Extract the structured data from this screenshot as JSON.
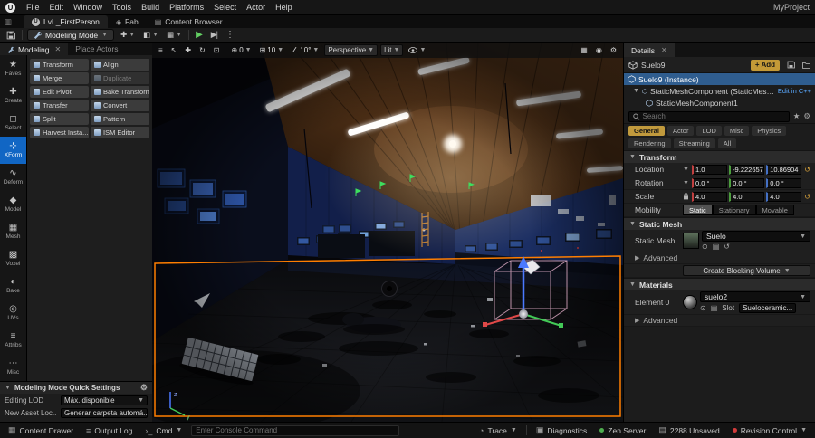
{
  "menubar": {
    "items": [
      "File",
      "Edit",
      "Window",
      "Tools",
      "Build",
      "Platforms",
      "Select",
      "Actor",
      "Help"
    ],
    "project": "MyProject"
  },
  "tabbar": {
    "level_tab": "LvL_FirstPerson",
    "fab": "Fab",
    "content_browser": "Content Browser"
  },
  "toolbar": {
    "mode_label": "Modeling Mode"
  },
  "left_tabs": {
    "modeling": "Modeling",
    "place_actors": "Place Actors"
  },
  "categories": [
    {
      "label": "Faves",
      "glyph": "★"
    },
    {
      "label": "Create",
      "glyph": "✚"
    },
    {
      "label": "Select",
      "glyph": "◻"
    },
    {
      "label": "XForm",
      "glyph": "⊹"
    },
    {
      "label": "Deform",
      "glyph": "∿"
    },
    {
      "label": "Model",
      "glyph": "◆"
    },
    {
      "label": "Mesh",
      "glyph": "▦"
    },
    {
      "label": "Voxel",
      "glyph": "▩"
    },
    {
      "label": "Bake",
      "glyph": "◐"
    },
    {
      "label": "UVs",
      "glyph": "◎"
    },
    {
      "label": "Attribs",
      "glyph": "≡"
    },
    {
      "label": "Misc",
      "glyph": "⋯"
    }
  ],
  "tools": {
    "col1": [
      "Transform",
      "Merge",
      "Edit Pivot",
      "Transfer",
      "Split",
      "Harvest Insta..."
    ],
    "col2": [
      "Align",
      "Duplicate",
      "Bake Transform",
      "Convert",
      "Pattern",
      "ISM Editor"
    ]
  },
  "quick_settings": {
    "title": "Modeling Mode Quick Settings",
    "editing_lod_label": "Editing LOD",
    "editing_lod_value": "Máx. disponible",
    "asset_loc_label": "New Asset Loc...",
    "asset_loc_value": "Generar carpeta automá..."
  },
  "viewport_bar": {
    "snap_surface": "0",
    "snap_grid": "10",
    "snap_angle": "10°",
    "perspective": "Perspective",
    "lit": "Lit"
  },
  "details": {
    "tab_title": "Details",
    "actor_name": "Suelo9",
    "add_button": "+ Add",
    "tree": [
      {
        "label": "Suelo9 (Instance)"
      },
      {
        "label": "StaticMeshComponent (StaticMeshComponent0)",
        "action": "Edit in C++"
      },
      {
        "label": "StaticMeshComponent1"
      }
    ],
    "search_placeholder": "Search",
    "filters_row1": [
      "General",
      "Actor",
      "LOD",
      "Misc",
      "Physics"
    ],
    "filters_row2": [
      "Rendering",
      "Streaming",
      "All"
    ],
    "transform_section": "Transform",
    "location_label": "Location",
    "location_values": [
      "1.0",
      "-9.222657",
      "10.86904"
    ],
    "rotation_label": "Rotation",
    "rotation_values": [
      "0.0 °",
      "0.0 °",
      "0.0 °"
    ],
    "scale_label": "Scale",
    "scale_values": [
      "4.0",
      "4.0",
      "4.0"
    ],
    "mobility_label": "Mobility",
    "mobility_options": [
      "Static",
      "Stationary",
      "Movable"
    ],
    "staticmesh_section": "Static Mesh",
    "staticmesh_label": "Static Mesh",
    "staticmesh_value": "Suelo",
    "advanced_label": "Advanced",
    "create_blocking": "Create Blocking Volume",
    "materials_section": "Materials",
    "element_label": "Element 0",
    "material_value": "suelo2",
    "slot_label": "Slot",
    "slot_value": "Sueloceramic...",
    "advanced2_label": "Advanced"
  },
  "statusbar": {
    "content_drawer": "Content Drawer",
    "output_log": "Output Log",
    "cmd": "Cmd",
    "console_placeholder": "Enter Console Command",
    "trace": "Trace",
    "diagnostics": "Diagnostics",
    "zen_server": "Zen Server",
    "unsaved": "2288 Unsaved",
    "revision_control": "Revision Control"
  }
}
